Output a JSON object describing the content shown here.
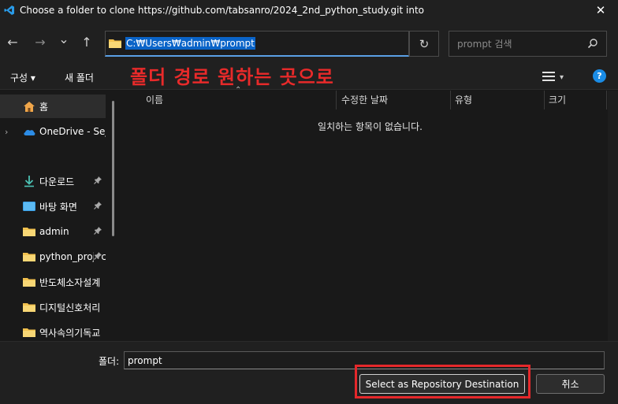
{
  "window": {
    "title": "Choose a folder to clone https://github.com/tabsanro/2024_2nd_python_study.git into",
    "close_glyph": "✕",
    "accent_color": "#0a64c8"
  },
  "nav": {
    "back_glyph": "←",
    "forward_glyph": "→",
    "recent_glyph": "⌄",
    "up_glyph": "↑",
    "address_path": "C:₩Users₩admin₩prompt",
    "dropdown_glyph": "⌄",
    "refresh_glyph": "↻",
    "search_placeholder": "prompt 검색"
  },
  "commands": {
    "organize": "구성 ▾",
    "new_folder": "새 폴더",
    "view_glyph": "▾",
    "help": "?"
  },
  "annotation": {
    "text": "폴더 경로 원하는 곳으로",
    "color": "#e82a2a"
  },
  "sidebar": {
    "items": [
      {
        "label": "홈",
        "icon": "home-icon",
        "pinned": false
      },
      {
        "label": "OneDrive - Sejong University",
        "icon": "onedrive-cloud-icon",
        "pinned": false
      },
      {
        "label": "다운로드",
        "icon": "download-icon",
        "pinned": true
      },
      {
        "label": "바탕 화면",
        "icon": "desktop-icon",
        "pinned": true
      },
      {
        "label": "admin",
        "icon": "folder-icon",
        "pinned": true
      },
      {
        "label": "python_project",
        "icon": "folder-icon",
        "pinned": true
      },
      {
        "label": "반도체소자설계",
        "icon": "folder-icon",
        "pinned": false
      },
      {
        "label": "디지털신호처리",
        "icon": "folder-icon",
        "pinned": false
      },
      {
        "label": "역사속의기독교",
        "icon": "folder-icon",
        "pinned": false
      }
    ],
    "pin_glyph": "📌",
    "expand_glyph": "›"
  },
  "file_list": {
    "columns": [
      "이름",
      "수정한 날짜",
      "유형",
      "크기"
    ],
    "empty_message": "일치하는 항목이 없습니다."
  },
  "footer": {
    "folder_label": "폴더:",
    "folder_value": "prompt",
    "select_button": "Select as Repository Destination",
    "cancel_button": "취소"
  }
}
